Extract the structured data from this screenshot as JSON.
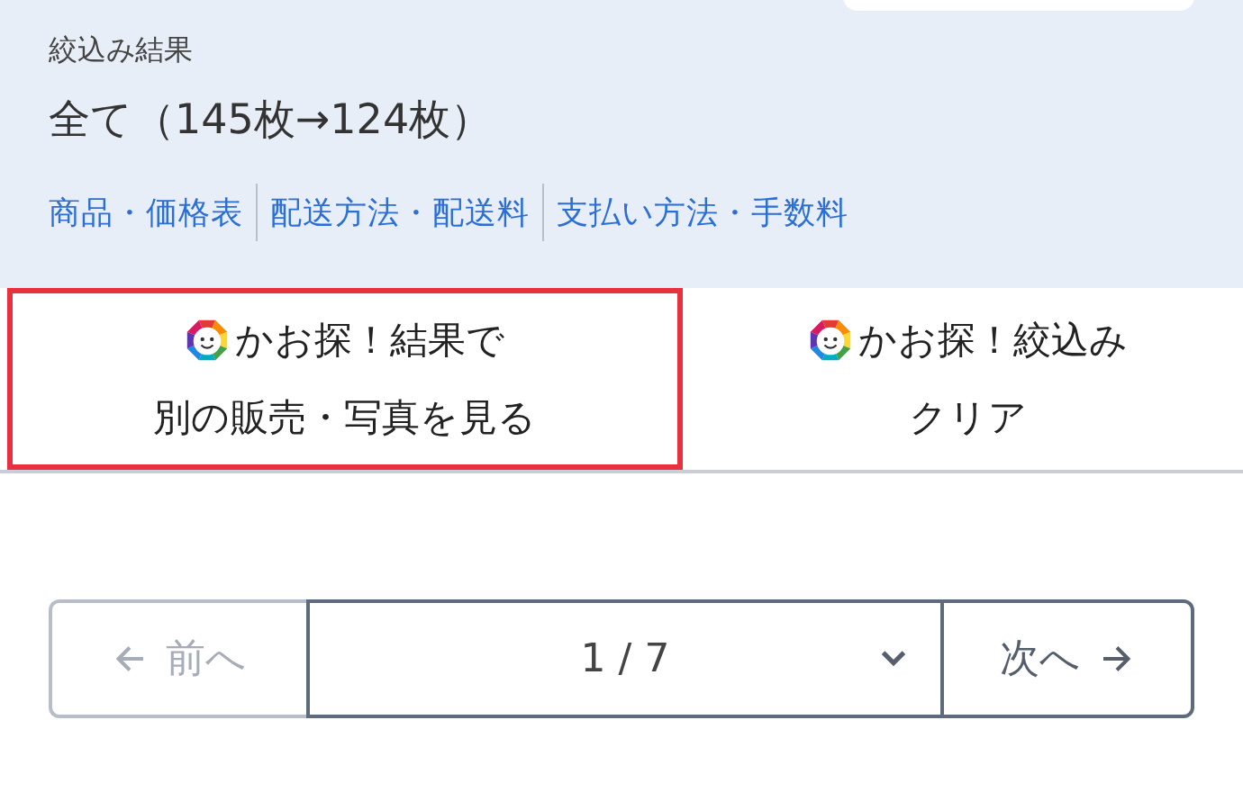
{
  "header": {
    "label": "絞込み結果",
    "summary": "全て（145枚→124枚）"
  },
  "links": [
    "商品・価格表",
    "配送方法・配送料",
    "支払い方法・手数料"
  ],
  "actions": [
    {
      "line1": "かお探！結果で",
      "line2": "別の販売・写真を見る",
      "selected": true
    },
    {
      "line1": "かお探！絞込み",
      "line2": "クリア",
      "selected": false
    }
  ],
  "pagination": {
    "prev": {
      "label": "前へ",
      "disabled": true
    },
    "page": "1 / 7",
    "next": {
      "label": "次へ",
      "disabled": false
    }
  }
}
